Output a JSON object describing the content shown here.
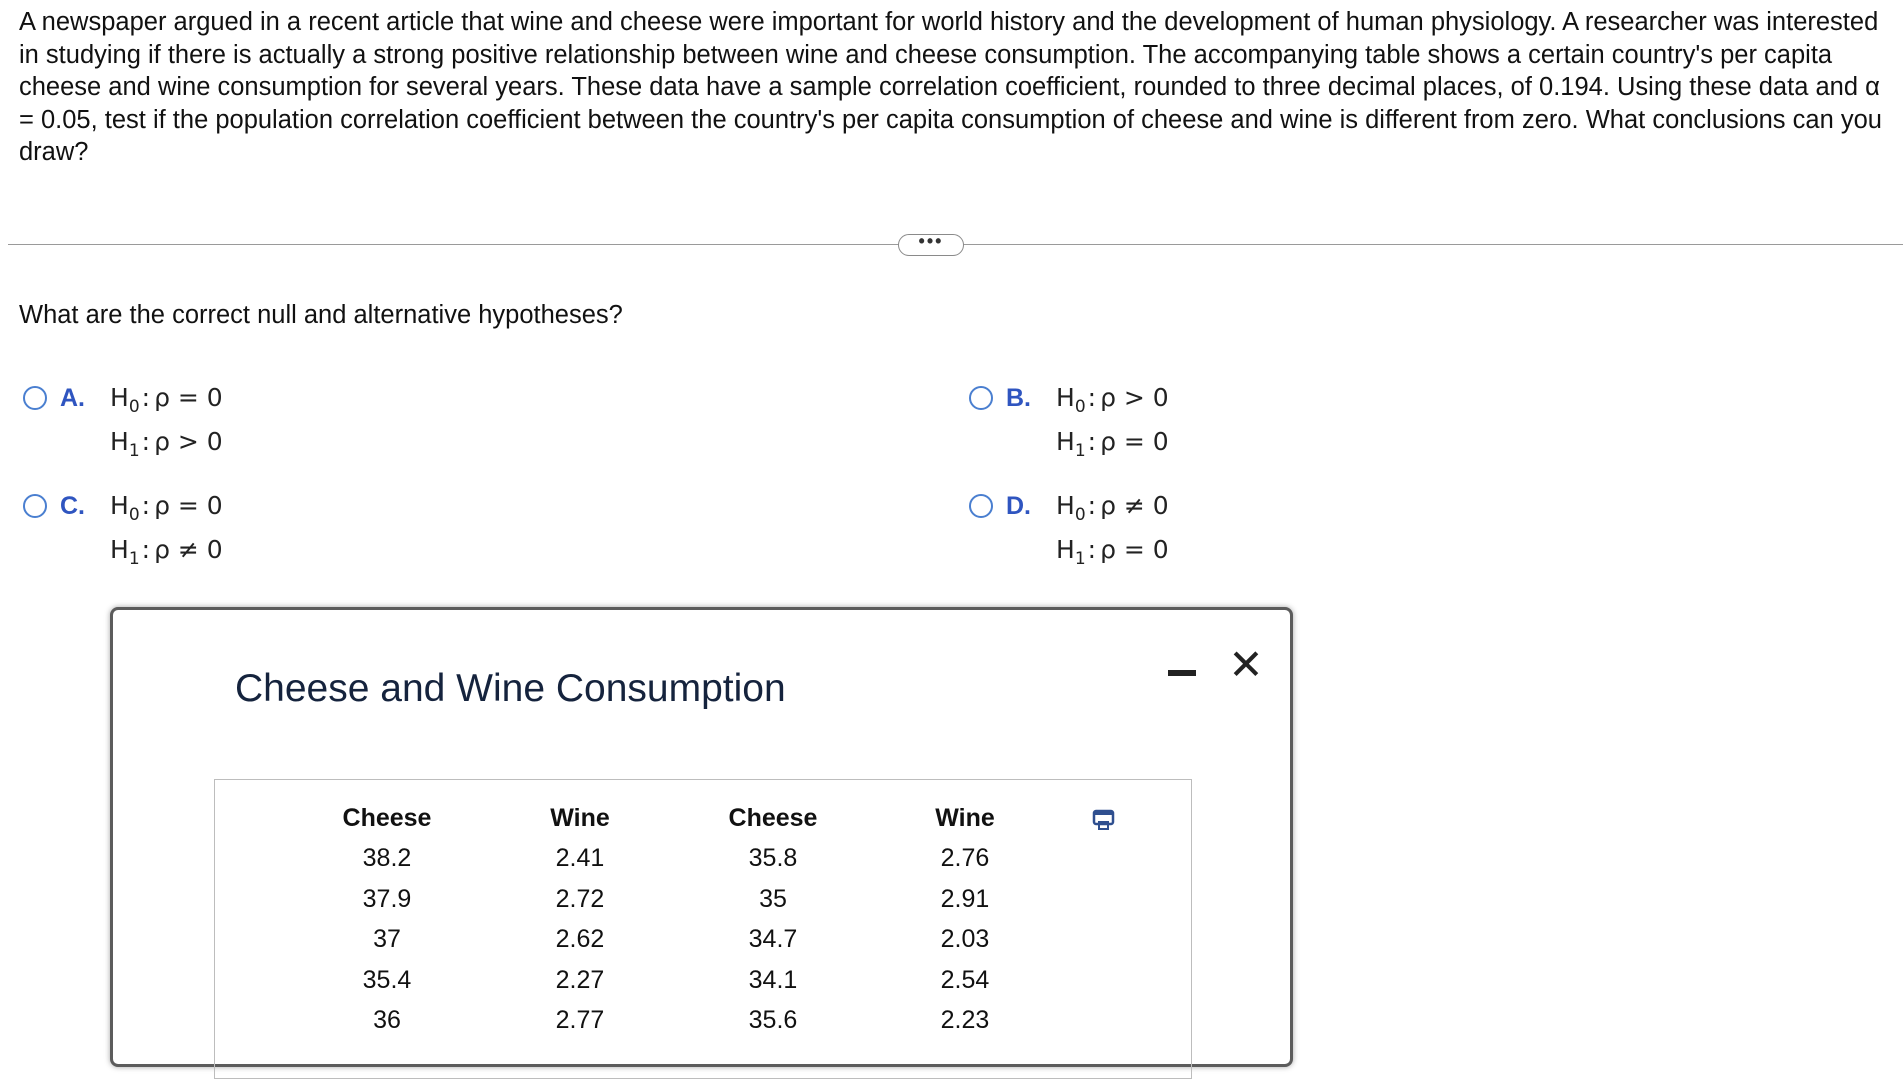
{
  "question": {
    "text": "A newspaper argued in a recent article that wine and cheese were important for world history and the development of human physiology. A researcher was interested in studying if there is actually a strong positive relationship between wine and cheese consumption. The accompanying table shows a certain country's per capita cheese and wine consumption for several years. These data have a sample correlation coefficient, rounded to three decimal places, of 0.194. Using these data and α = 0.05, test if the population correlation coefficient between the country's per capita consumption of cheese and wine is different from zero. What conclusions can you draw?"
  },
  "more_button": {
    "label": "•••"
  },
  "subquestion": "What are the correct null and alternative hypotheses?",
  "options": [
    {
      "letter": "A.",
      "h0_label": "H",
      "h0_sub": "0",
      "h0_rel": "ρ = 0",
      "h1_label": "H",
      "h1_sub": "1",
      "h1_rel": "ρ > 0"
    },
    {
      "letter": "B.",
      "h0_label": "H",
      "h0_sub": "0",
      "h0_rel": "ρ > 0",
      "h1_label": "H",
      "h1_sub": "1",
      "h1_rel": "ρ = 0"
    },
    {
      "letter": "C.",
      "h0_label": "H",
      "h0_sub": "0",
      "h0_rel": "ρ = 0",
      "h1_label": "H",
      "h1_sub": "1",
      "h1_rel": "ρ ≠ 0"
    },
    {
      "letter": "D.",
      "h0_label": "H",
      "h0_sub": "0",
      "h0_rel": "ρ ≠ 0",
      "h1_label": "H",
      "h1_sub": "1",
      "h1_rel": "ρ = 0"
    }
  ],
  "dialog": {
    "title": "Cheese and Wine Consumption",
    "minimize_icon": "minimize-icon",
    "close_icon": "close-icon",
    "copy_icon": "copy-icon",
    "columns": [
      {
        "header": "Cheese",
        "values": [
          "38.2",
          "37.9",
          "37",
          "35.4",
          "36"
        ]
      },
      {
        "header": "Wine",
        "values": [
          "2.41",
          "2.72",
          "2.62",
          "2.27",
          "2.77"
        ]
      },
      {
        "header": "Cheese",
        "values": [
          "35.8",
          "35",
          "34.7",
          "34.1",
          "35.6"
        ]
      },
      {
        "header": "Wine",
        "values": [
          "2.76",
          "2.91",
          "2.03",
          "2.54",
          "2.23"
        ]
      }
    ]
  },
  "colors": {
    "accent": "#2f55c0",
    "radio": "#4a7fd0"
  }
}
